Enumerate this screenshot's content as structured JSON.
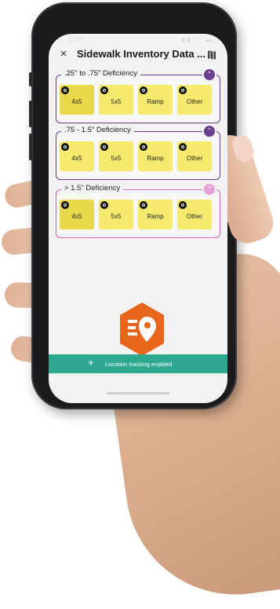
{
  "status_bar": {
    "time": "11:58",
    "icons": "▮▮ ◠ ▬"
  },
  "header": {
    "close_label": "×",
    "title": "Sidewalk Inventory Data ..."
  },
  "groups": [
    {
      "title": ".25\" to .75\" Deficiency",
      "collapse_symbol": "⌃",
      "tiles": [
        "4x5",
        "5x5",
        "Ramp",
        "Other"
      ],
      "selected_tile": "4x5"
    },
    {
      "title": ".75 - 1.5\" Deficiency",
      "collapse_symbol": "⌃",
      "tiles": [
        "4x5",
        "5x5",
        "Ramp",
        "Other"
      ],
      "selected_tile": ""
    },
    {
      "title": "> 1.5\" Deficiency",
      "collapse_symbol": "⌃",
      "tiles": [
        "4x5",
        "5x5",
        "Ramp",
        "Other"
      ],
      "selected_tile": "4x5"
    }
  ],
  "location_bar": {
    "icon": "location-tracking-icon",
    "text": "Location tracking enabled"
  },
  "colors": {
    "accent_purple": "#6b3f8f",
    "accent_pink": "#d65fb8",
    "tile_yellow": "#f5ea6e",
    "tile_selected": "#e8d84a",
    "location_bar": "#2ea890",
    "logo_orange": "#e8661b"
  }
}
